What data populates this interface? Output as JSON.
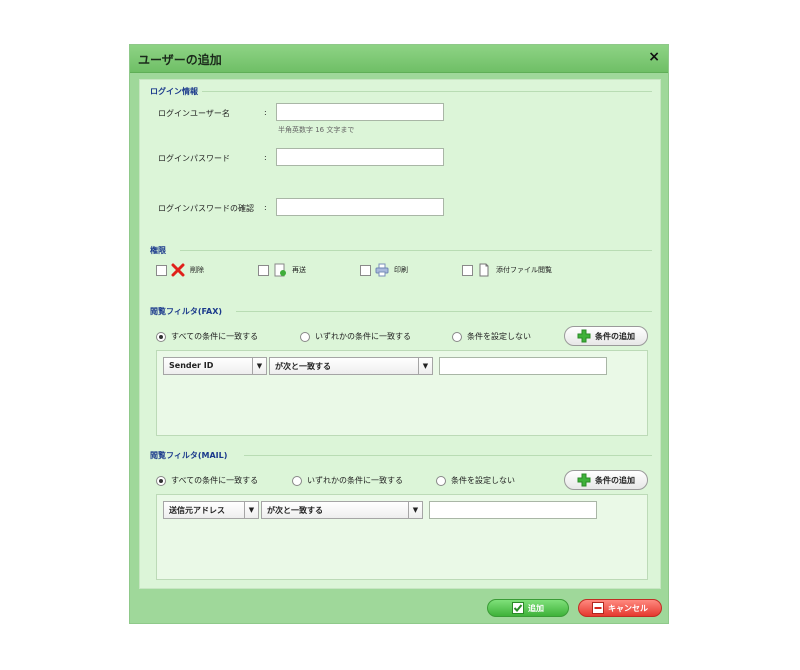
{
  "dialog": {
    "title": "ユーザーの追加",
    "close_label": "×"
  },
  "login": {
    "section_title": "ログイン情報",
    "username_label": "ログインユーザー名",
    "username_hint": "半角英数字 16 文字まで",
    "username_value": "",
    "password_label": "ログインパスワード",
    "password_value": "",
    "confirm_label": "ログインパスワードの確認",
    "confirm_value": "",
    "colon": ":"
  },
  "permissions": {
    "section_title": "権限",
    "items": [
      {
        "label": "削除",
        "icon": "delete-x-icon",
        "checked": false
      },
      {
        "label": "再送",
        "icon": "resend-document-icon",
        "checked": false
      },
      {
        "label": "印刷",
        "icon": "printer-icon",
        "checked": false
      },
      {
        "label": "添付ファイル閲覧",
        "icon": "attachment-document-icon",
        "checked": false
      }
    ]
  },
  "filter_fax": {
    "section_title": "閲覧フィルタ(FAX)",
    "radio_options": [
      "すべての条件に一致する",
      "いずれかの条件に一致する",
      "条件を設定しない"
    ],
    "selected_index": 0,
    "add_condition_label": "条件の追加",
    "field_select": "Sender ID",
    "operator_select": "が次と一致する",
    "value": ""
  },
  "filter_mail": {
    "section_title": "閲覧フィルタ(MAIL)",
    "radio_options": [
      "すべての条件に一致する",
      "いずれかの条件に一致する",
      "条件を設定しない"
    ],
    "selected_index": 0,
    "add_condition_label": "条件の追加",
    "field_select": "送信元アドレス",
    "operator_select": "が次と一致する",
    "value": ""
  },
  "footer": {
    "add_label": "追加",
    "cancel_label": "キャンセル"
  },
  "colors": {
    "section_title": "#1b3a8c",
    "add_button": "#3fb23a",
    "cancel_button": "#e53a2f"
  }
}
